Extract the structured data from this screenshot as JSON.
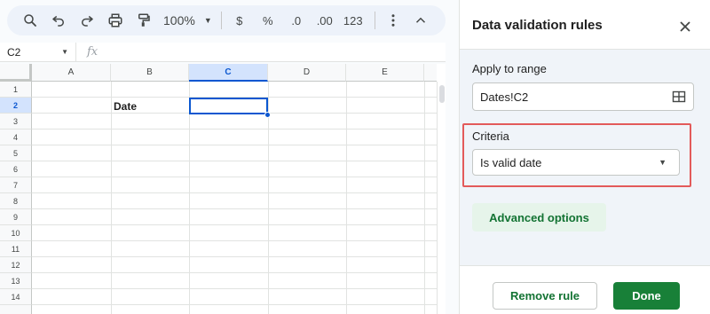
{
  "toolbar": {
    "zoom": "100%",
    "currency": "$",
    "percent": "%",
    "decrease_decimals": ".0",
    "increase_decimals": ".00",
    "number_format": "123",
    "icons": [
      "search-icon",
      "undo-icon",
      "redo-icon",
      "print-icon",
      "paint-format-icon",
      "more-vert-icon",
      "chevron-up-icon"
    ]
  },
  "formula_bar": {
    "cell_ref": "C2",
    "fx_label": "fx"
  },
  "grid": {
    "columns": [
      "A",
      "B",
      "C",
      "D",
      "E"
    ],
    "rows": [
      "1",
      "2",
      "3",
      "4",
      "5",
      "6",
      "7",
      "8",
      "9",
      "10",
      "11",
      "12",
      "13",
      "14"
    ],
    "selected_column": "C",
    "selected_row": "2",
    "cells": {
      "B2": "Date"
    }
  },
  "panel": {
    "title": "Data validation rules",
    "apply_label": "Apply to range",
    "range_value": "Dates!C2",
    "criteria_label": "Criteria",
    "criteria_value": "Is valid date",
    "advanced_label": "Advanced options",
    "remove_label": "Remove rule",
    "done_label": "Done",
    "colors": {
      "accent": "#0b57d0",
      "green": "#188038",
      "highlight": "#e35a5a"
    }
  }
}
